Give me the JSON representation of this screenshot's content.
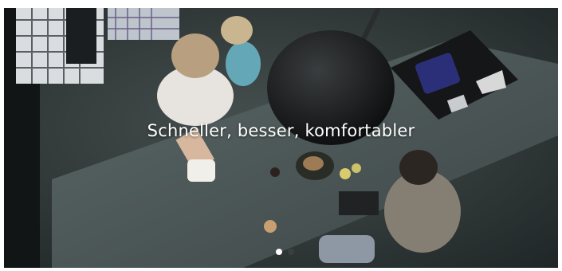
{
  "hero": {
    "headline": "Schneller, besser, komfortabler"
  },
  "carousel": {
    "slide_count": 2,
    "active_index": 0,
    "active_color": "#ffffff",
    "inactive_color": "#3a3f40"
  },
  "colors": {
    "background": "#2b3234",
    "countertop": "#4f5a5b",
    "cooktop": "#151617"
  }
}
